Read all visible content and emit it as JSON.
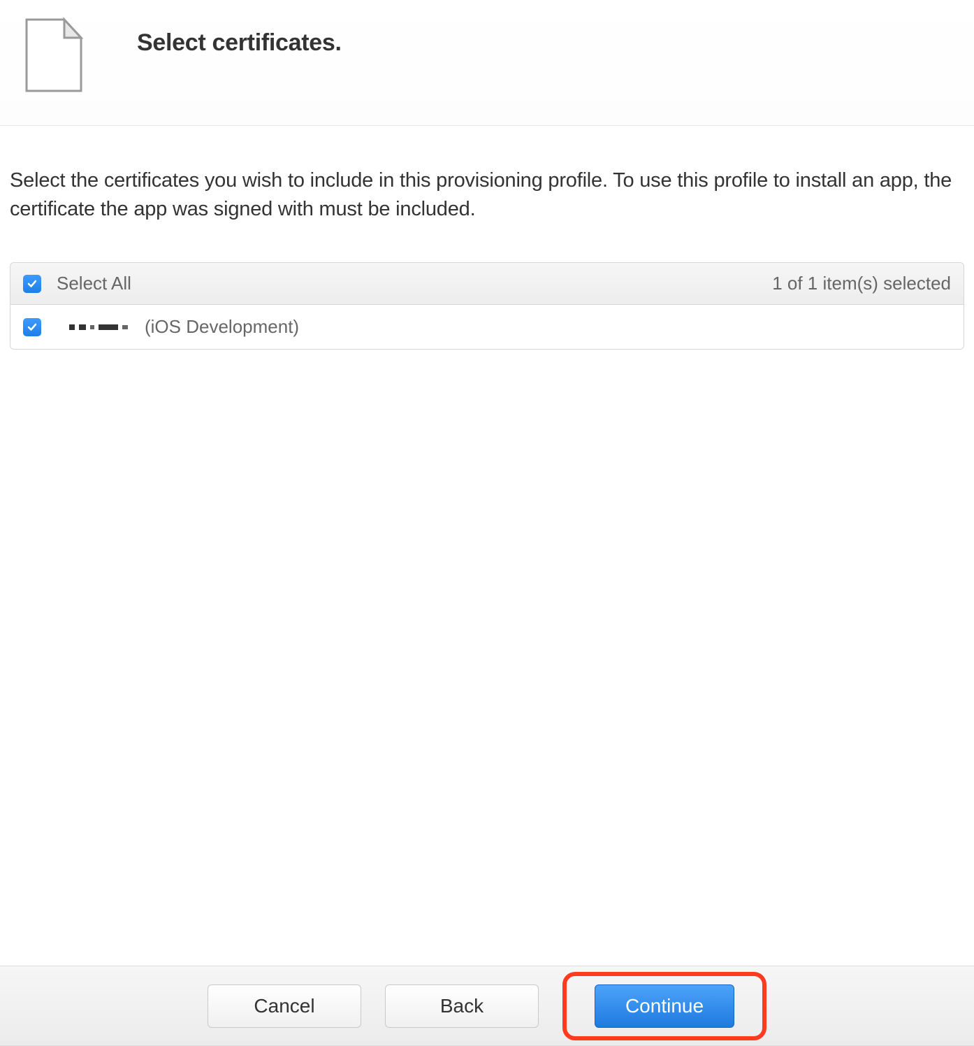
{
  "header": {
    "title": "Select certificates."
  },
  "instructions": "Select the certificates you wish to include in this provisioning profile. To use this profile to install an app, the certificate the app was signed with must be included.",
  "table": {
    "selectAllLabel": "Select All",
    "selectionCount": "1  of 1 item(s) selected",
    "rows": [
      {
        "typeLabel": "(iOS Development)"
      }
    ]
  },
  "footer": {
    "cancel": "Cancel",
    "back": "Back",
    "continue": "Continue"
  }
}
